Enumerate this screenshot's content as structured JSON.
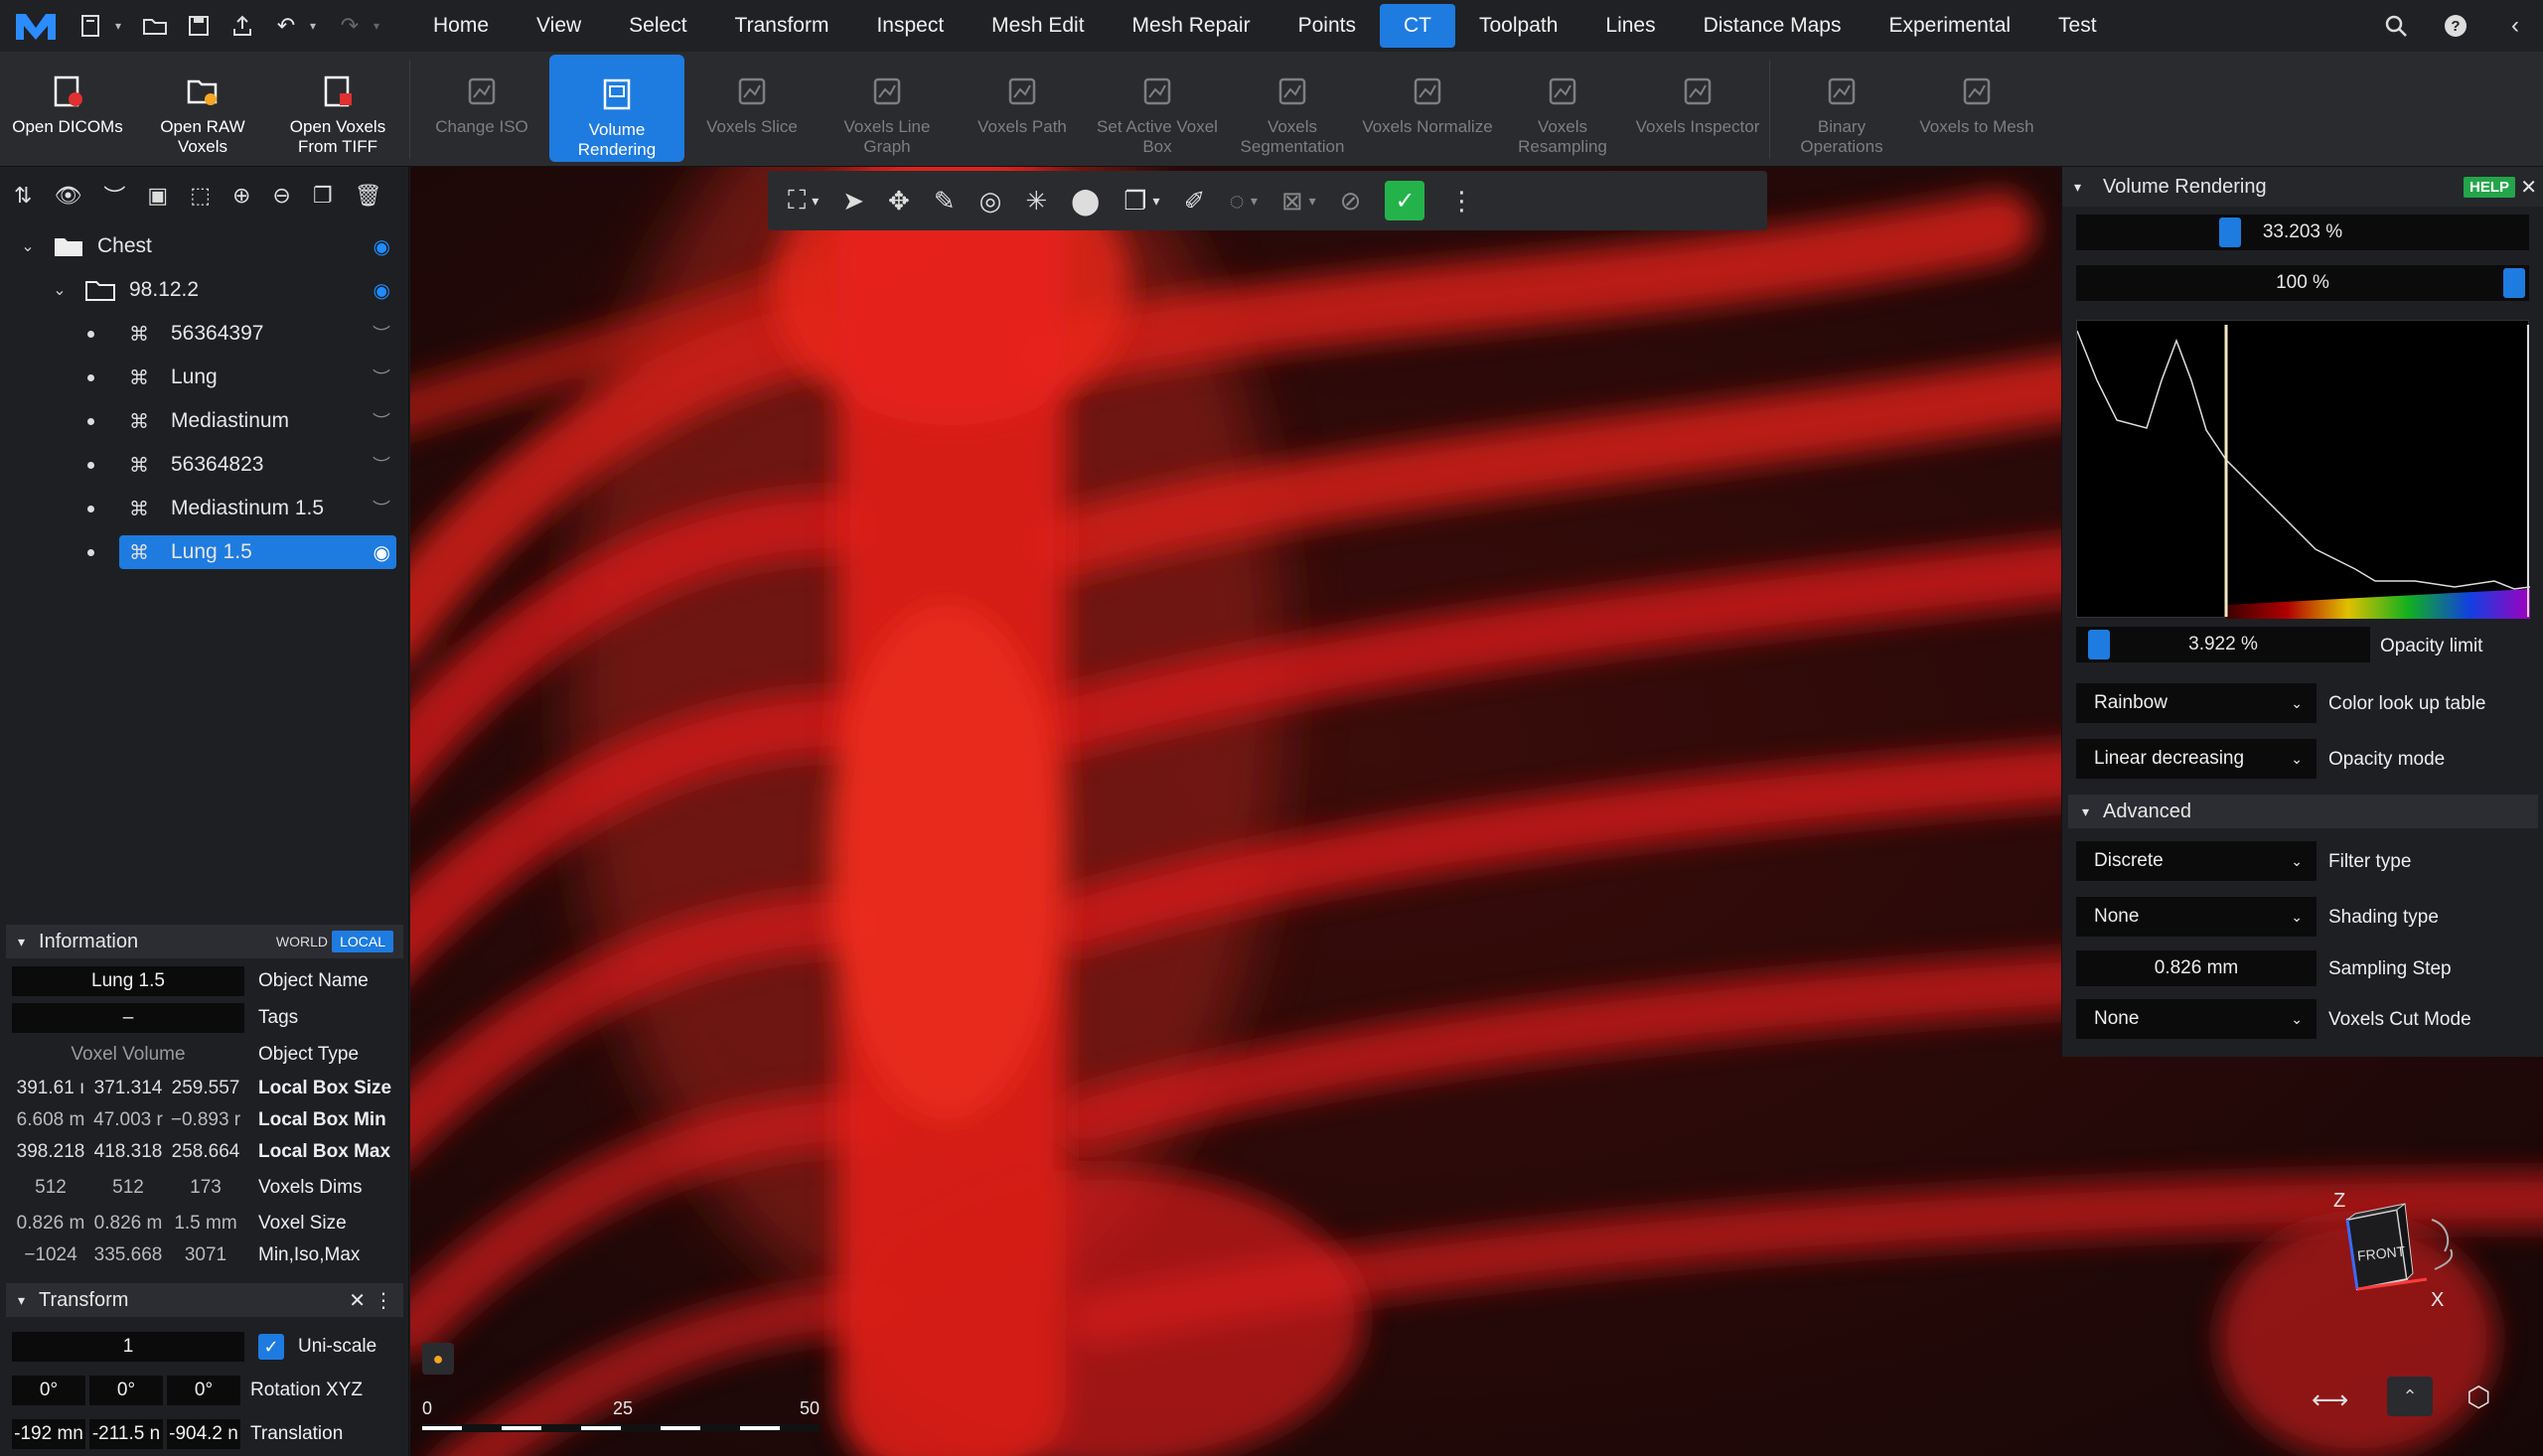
{
  "menu": {
    "items": [
      "Home",
      "View",
      "Select",
      "Transform",
      "Inspect",
      "Mesh Edit",
      "Mesh Repair",
      "Points",
      "CT",
      "Toolpath",
      "Lines",
      "Distance Maps",
      "Experimental",
      "Test"
    ],
    "active": "CT"
  },
  "ribbon": [
    {
      "label": "Open DICOMs",
      "state": "normal",
      "icon": "dicom-icon"
    },
    {
      "label": "Open RAW Voxels",
      "state": "normal",
      "icon": "raw-voxels-icon"
    },
    {
      "label": "Open Voxels From TIFF",
      "state": "normal",
      "icon": "tiff-icon"
    },
    {
      "label": "Change ISO",
      "state": "disabled",
      "icon": "iso-icon"
    },
    {
      "label": "Volume Rendering",
      "state": "selected",
      "icon": "volume-icon"
    },
    {
      "label": "Voxels Slice",
      "state": "disabled",
      "icon": "slice-icon"
    },
    {
      "label": "Voxels Line Graph",
      "state": "disabled",
      "icon": "line-graph-icon"
    },
    {
      "label": "Voxels Path",
      "state": "disabled",
      "icon": "path-icon"
    },
    {
      "label": "Set Active Voxel Box",
      "state": "disabled",
      "icon": "voxel-box-icon"
    },
    {
      "label": "Voxels Segmentation",
      "state": "disabled",
      "icon": "segmentation-icon"
    },
    {
      "label": "Voxels Normalize",
      "state": "disabled",
      "icon": "normalize-icon"
    },
    {
      "label": "Voxels Resampling",
      "state": "disabled",
      "icon": "resampling-icon"
    },
    {
      "label": "Voxels Inspector",
      "state": "disabled",
      "icon": "inspector-icon"
    },
    {
      "label": "Binary Operations",
      "state": "disabled",
      "icon": "binary-icon"
    },
    {
      "label": "Voxels to Mesh",
      "state": "disabled",
      "icon": "to-mesh-icon"
    }
  ],
  "tree": {
    "root": "Chest",
    "folder": "98.12.2",
    "items": [
      "56364397",
      "Lung",
      "Mediastinum",
      "56364823",
      "Mediastinum 1.5",
      "Lung 1.5"
    ],
    "selected": "Lung 1.5"
  },
  "info": {
    "title": "Information",
    "world": "WORLD",
    "local": "LOCAL",
    "object_name": "Lung 1.5",
    "object_name_label": "Object Name",
    "tags": "–",
    "tags_label": "Tags",
    "object_type": "Voxel Volume",
    "object_type_label": "Object Type",
    "box_size": [
      "391.61 ı",
      "371.314",
      "259.557"
    ],
    "box_size_label": "Local Box Size",
    "box_min": [
      "6.608 m",
      "47.003 r",
      "−0.893 r"
    ],
    "box_min_label": "Local Box Min",
    "box_max": [
      "398.218",
      "418.318",
      "258.664"
    ],
    "box_max_label": "Local Box Max",
    "dims": [
      "512",
      "512",
      "173"
    ],
    "dims_label": "Voxels Dims",
    "voxel_size": [
      "0.826 m",
      "0.826 m",
      "1.5 mm"
    ],
    "voxel_size_label": "Voxel Size",
    "miniso": [
      "−1024",
      "335.668",
      "3071"
    ],
    "miniso_label": "Min,Iso,Max"
  },
  "transform": {
    "title": "Transform",
    "scale": "1",
    "uniscale_label": "Uni-scale",
    "rotation": [
      "0°",
      "0°",
      "0°"
    ],
    "rotation_label": "Rotation XYZ",
    "translation": [
      "-192 mn",
      "-211.5 n",
      "-904.2 n"
    ],
    "translation_label": "Translation"
  },
  "scale_bar": {
    "ticks": [
      "0",
      "25",
      "50"
    ]
  },
  "view_cube": {
    "face": "FRONT",
    "axis_z": "Z",
    "axis_x": "X"
  },
  "volume_rendering": {
    "title": "Volume Rendering",
    "help": "HELP",
    "slider1": {
      "text": "33.203 %",
      "value": 0.332
    },
    "slider2": {
      "text": "100 %",
      "value": 1.0
    },
    "opacity_limit": {
      "text": "3.922 %",
      "label": "Opacity limit"
    },
    "color_lut": {
      "value": "Rainbow",
      "label": "Color look up table"
    },
    "opacity_mode": {
      "value": "Linear decreasing",
      "label": "Opacity mode"
    },
    "advanced": "Advanced",
    "filter_type": {
      "value": "Discrete",
      "label": "Filter type"
    },
    "shading_type": {
      "value": "None",
      "label": "Shading type"
    },
    "sampling_step": {
      "value": "0.826 mm",
      "label": "Sampling Step"
    },
    "cut_mode": {
      "value": "None",
      "label": "Voxels Cut Mode"
    }
  },
  "colors": {
    "accent": "#1e7be0",
    "help": "#23a54a",
    "bone": "#e0201a"
  }
}
